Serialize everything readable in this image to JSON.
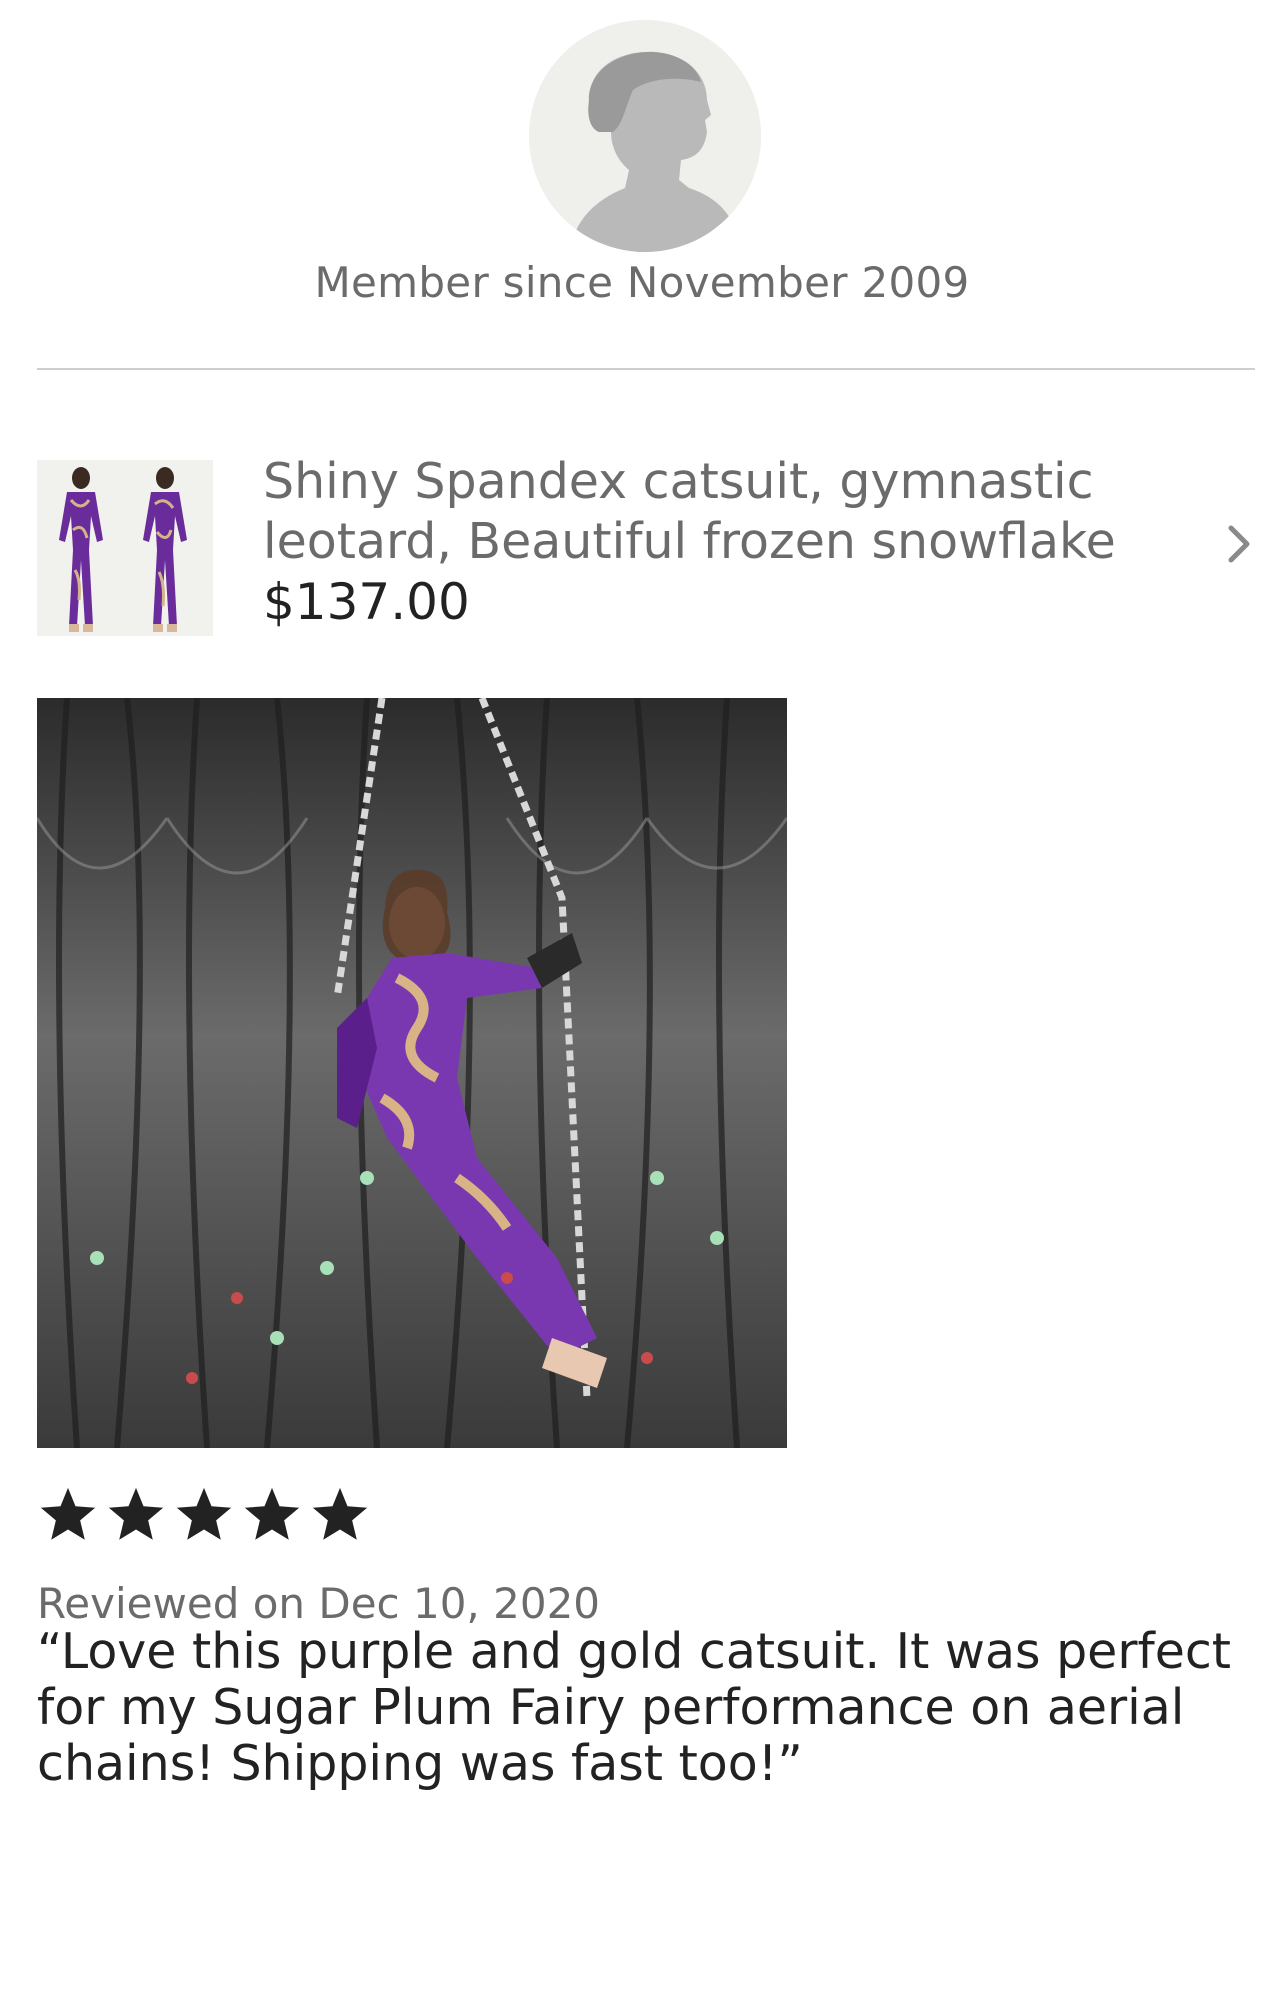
{
  "profile": {
    "avatar_icon": "person-silhouette-icon",
    "member_since": "Member since November 2009"
  },
  "listing": {
    "title": "Shiny Spandex catsuit, gymnastic leotard, Beautiful frozen snowflake",
    "price": "$137.00",
    "thumbnail_icon": "product-thumbnail",
    "chevron_icon": "chevron-right-icon"
  },
  "review": {
    "photo": "review-photo",
    "rating": 5,
    "star_color": "#222222",
    "reviewed_on": "Reviewed on Dec 10, 2020",
    "text": "“Love this purple and gold catsuit. It was perfect for my Sugar Plum Fairy performance on aerial chains! Shipping was fast too!”"
  }
}
